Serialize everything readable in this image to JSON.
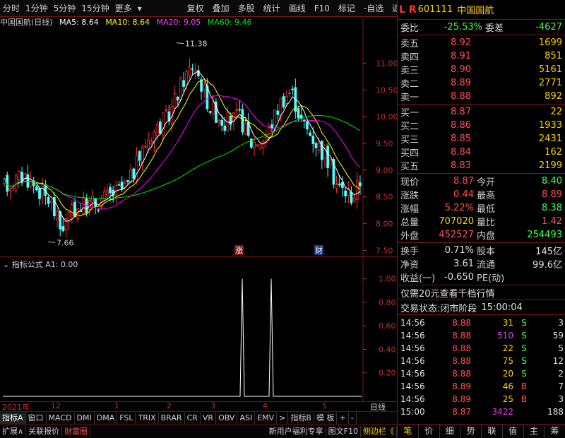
{
  "toolbar": {
    "periods": [
      "分时",
      "1分钟",
      "5分钟",
      "15分钟",
      "更多"
    ],
    "actions": [
      "复权",
      "叠加",
      "多股",
      "统计",
      "画线",
      "F10",
      "标记",
      "-自选",
      "返回"
    ]
  },
  "chart": {
    "title": "中国国航(日线)",
    "ma5_label": "MA5: 8.64",
    "ma10_label": "MA10: 8.64",
    "ma20_label": "MA20: 9.05",
    "ma60_label": "MA60: 9.46",
    "max_label": "11.38",
    "min_label": "7.66",
    "badge_zhang": "涨",
    "badge_cai": "财",
    "colors": {
      "up": "#ff3232",
      "down": "#54fcfc",
      "ma5": "#ffffff",
      "ma10": "#ffff00",
      "ma20": "#ff00ff",
      "ma60": "#00e600"
    }
  },
  "chart_data": [
    {
      "type": "candlestick",
      "title": "中国国航(日线)",
      "ylim": [
        7.4,
        11.6
      ],
      "yticks": [
        "11.00",
        "10.50",
        "10.00",
        "9.50",
        "9.00",
        "8.50",
        "8.00",
        "7.50"
      ],
      "x_labels": [
        "2021年",
        "12",
        "1",
        "2",
        "3",
        "4",
        "5"
      ],
      "annotations": [
        "11.38",
        "7.66"
      ],
      "series": [
        {
          "name": "MA5",
          "value": 8.64
        },
        {
          "name": "MA10",
          "value": 8.64
        },
        {
          "name": "MA20",
          "value": 9.05
        },
        {
          "name": "MA60",
          "value": 9.46
        }
      ]
    },
    {
      "type": "line",
      "title": "指标公式 A1: 0.00",
      "ylim": [
        0,
        1.1
      ],
      "yticks": [
        "1.00",
        "0.80",
        "0.60",
        "0.40",
        "0.20"
      ],
      "spikes": [
        {
          "value": 1.0
        },
        {
          "value": 1.0
        }
      ]
    }
  ],
  "indicator": {
    "title": "指标公式  A1: 0.00"
  },
  "time_axis": [
    "2021年",
    "12",
    "1",
    "2",
    "3",
    "4",
    "5"
  ],
  "day_label": "日线",
  "indicator_tabs": [
    "指标A",
    "窗口",
    "MACD",
    "DMI",
    "DMA",
    "FSL",
    "TRIX",
    "BRAR",
    "CR",
    "VR",
    "OBV",
    "ASI",
    "EMV",
    ">",
    "指标B",
    "模 板",
    "+",
    "-"
  ],
  "bottom_bar": {
    "expand": "扩展∧",
    "related": "关联报价",
    "wealth": "财富圈",
    "new_user": "新用户福利专享",
    "f10": "图文F10",
    "sidebar": "侧边栏《"
  },
  "stock": {
    "lr": "L R",
    "code": "601111",
    "name": "中国国航"
  },
  "weibi": {
    "label": "委比",
    "value": "-25.53%",
    "diff_label": "委差",
    "diff": "-4627"
  },
  "asks": [
    {
      "label": "卖五",
      "price": "8.92",
      "vol": "1699"
    },
    {
      "label": "卖四",
      "price": "8.91",
      "vol": "851"
    },
    {
      "label": "卖三",
      "price": "8.90",
      "vol": "5161"
    },
    {
      "label": "卖二",
      "price": "8.89",
      "vol": "2771"
    },
    {
      "label": "卖一",
      "price": "8.88",
      "vol": "892"
    }
  ],
  "bids": [
    {
      "label": "买一",
      "price": "8.87",
      "vol": "22"
    },
    {
      "label": "买二",
      "price": "8.86",
      "vol": "1933"
    },
    {
      "label": "买三",
      "price": "8.85",
      "vol": "2431"
    },
    {
      "label": "买四",
      "price": "8.84",
      "vol": "162"
    },
    {
      "label": "买五",
      "price": "8.83",
      "vol": "2199"
    }
  ],
  "quote": [
    {
      "l1": "现价",
      "v1": "8.87",
      "l2": "今开",
      "v2": "8.40"
    },
    {
      "l1": "涨跌",
      "v1": "0.44",
      "l2": "最高",
      "v2": "8.89"
    },
    {
      "l1": "涨幅",
      "v1": "5.22%",
      "l2": "最低",
      "v2": "8.38"
    },
    {
      "l1": "总量",
      "v1": "707020",
      "l2": "量比",
      "v2": "1.42"
    },
    {
      "l1": "外盘",
      "v1": "452527",
      "l2": "内盘",
      "v2": "254493"
    }
  ],
  "fund": [
    {
      "l1": "换手",
      "v1": "0.71%",
      "l2": "股本",
      "v2": "145亿"
    },
    {
      "l1": "净资",
      "v1": "3.61",
      "l2": "流通",
      "v2": "99.6亿"
    },
    {
      "l1": "收益(一)",
      "v1": "-0.650",
      "l2": "PE(动)",
      "v2": ""
    }
  ],
  "promo": "仅需20元查看千档行情",
  "trade_status": {
    "label": "交易状态:",
    "value": "闭市阶段",
    "time": "15:00:04"
  },
  "ticks": [
    {
      "t": "14:56",
      "p": "8.88",
      "v": "31",
      "d": "S",
      "n": "3"
    },
    {
      "t": "14:56",
      "p": "8.88",
      "v": "510",
      "d": "S",
      "n": "59"
    },
    {
      "t": "14:56",
      "p": "8.88",
      "v": "22",
      "d": "S",
      "n": "5"
    },
    {
      "t": "14:56",
      "p": "8.88",
      "v": "75",
      "d": "S",
      "n": "12"
    },
    {
      "t": "14:56",
      "p": "8.88",
      "v": "20",
      "d": "S",
      "n": "2"
    },
    {
      "t": "14:56",
      "p": "8.89",
      "v": "46",
      "d": "B",
      "n": "7"
    },
    {
      "t": "14:56",
      "p": "8.89",
      "v": "25",
      "d": "B",
      "n": "3"
    },
    {
      "t": "15:00",
      "p": "8.87",
      "v": "3422",
      "d": "",
      "n": "188"
    }
  ],
  "right_tabs": [
    "笔",
    "价",
    "细",
    "势",
    "联",
    "值",
    "主",
    "筹"
  ]
}
